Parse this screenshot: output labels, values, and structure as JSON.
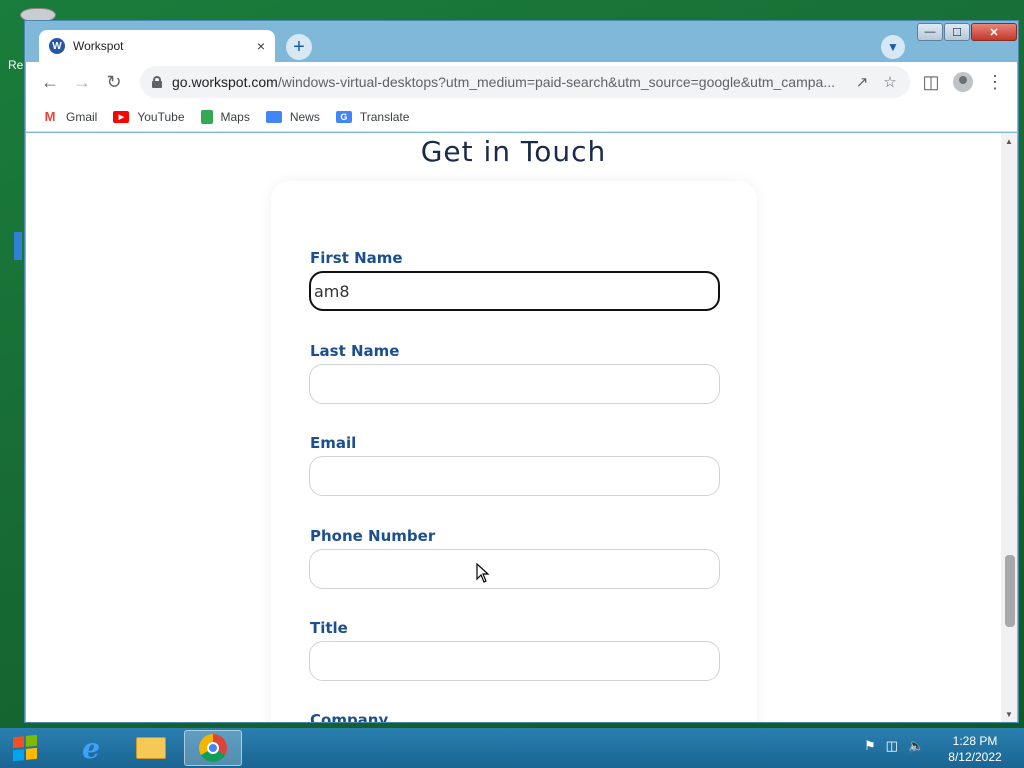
{
  "desktop": {
    "edge_text": "Re"
  },
  "window": {
    "controls": {
      "minimize": "—",
      "maximize": "☐",
      "close": "✕"
    }
  },
  "tab": {
    "title": "Workspot",
    "favicon_letter": "W",
    "close": "×"
  },
  "toolbar": {
    "url_host": "go.workspot.com",
    "url_path": "/windows-virtual-desktops?utm_medium=paid-search&utm_source=google&utm_campa..."
  },
  "bookmarks": [
    {
      "label": "Gmail",
      "icon": "gmail-icon",
      "color": "#ea4335"
    },
    {
      "label": "YouTube",
      "icon": "youtube-icon",
      "color": "#ff0000"
    },
    {
      "label": "Maps",
      "icon": "maps-icon",
      "color": "#34a853"
    },
    {
      "label": "News",
      "icon": "news-icon",
      "color": "#4285f4"
    },
    {
      "label": "Translate",
      "icon": "translate-icon",
      "color": "#4285f4"
    }
  ],
  "form": {
    "title": "Get in Touch",
    "fields": [
      {
        "label": "First Name",
        "value": "am8"
      },
      {
        "label": "Last Name",
        "value": ""
      },
      {
        "label": "Email",
        "value": ""
      },
      {
        "label": "Phone Number",
        "value": ""
      },
      {
        "label": "Title",
        "value": ""
      },
      {
        "label": "Company",
        "value": ""
      }
    ]
  },
  "taskbar": {
    "time": "1:28 PM",
    "date": "8/12/2022"
  },
  "colors": {
    "label": "#1c4f8e",
    "heading": "#1b2a4a",
    "window_frame": "#7fb8d9",
    "taskbar": "#1b6593"
  }
}
